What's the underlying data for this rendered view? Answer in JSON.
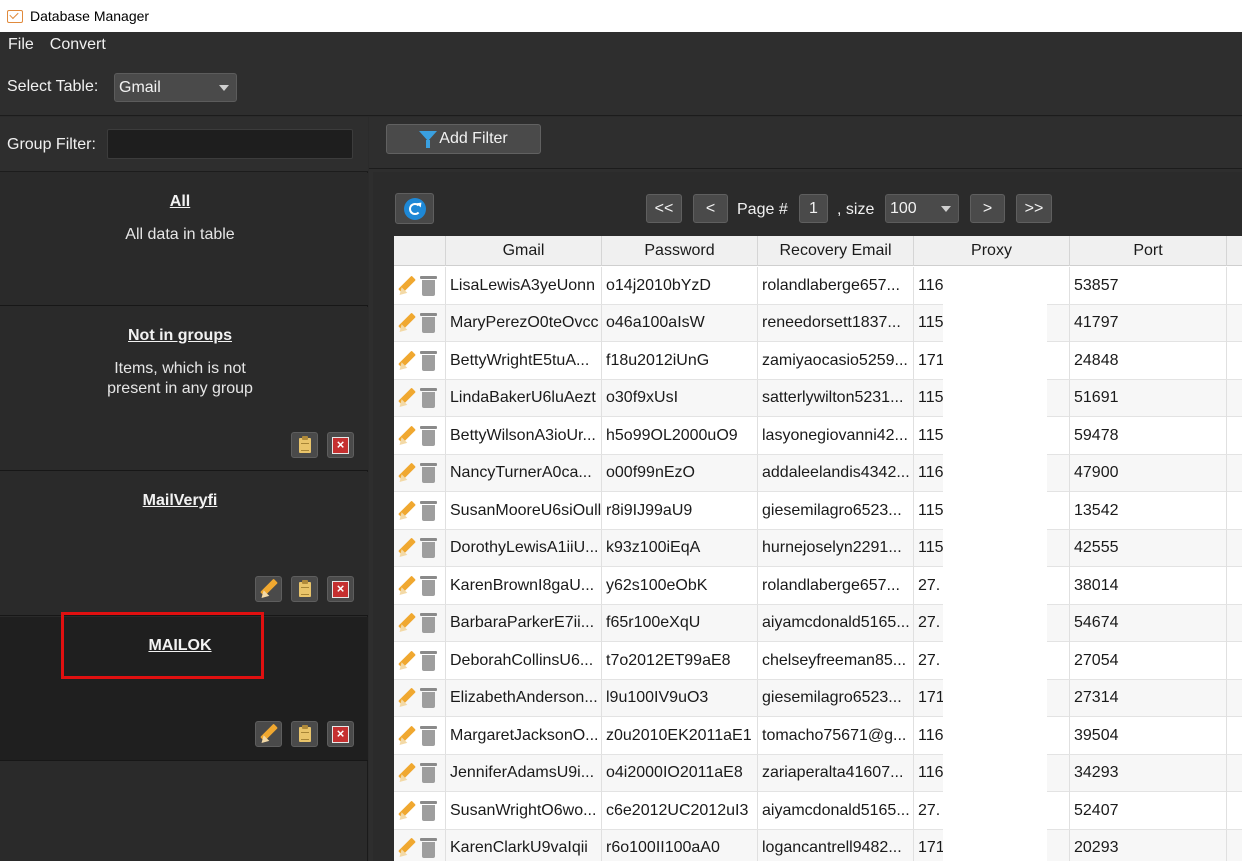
{
  "window": {
    "title": "Database Manager"
  },
  "menu": [
    "File",
    "Convert"
  ],
  "table_select": {
    "label": "Select Table:",
    "value": "Gmail"
  },
  "group_filter": {
    "label": "Group Filter:",
    "value": ""
  },
  "groups": [
    {
      "name": "All",
      "description": "All data in table"
    },
    {
      "name": "Not in groups",
      "description_lines": [
        "Items, which is not",
        "present in any group"
      ]
    },
    {
      "name": "MailVeryfi",
      "description": ""
    },
    {
      "name": "MAILOK",
      "description": ""
    }
  ],
  "toolbar": {
    "add_filter": "Add Filter"
  },
  "pager": {
    "first": "<<",
    "prev": "<",
    "page_label": "Page #",
    "page": "1",
    "size_label": ", size",
    "size": "100",
    "next": ">",
    "last": ">>"
  },
  "columns": [
    "Gmail",
    "Password",
    "Recovery Email",
    "Proxy",
    "Port"
  ],
  "rows": [
    [
      "LisaLewisA3yeUonn",
      "o14j2010bYzD",
      "rolandlaberge657...",
      "116",
      "53857"
    ],
    [
      "MaryPerezO0teOvcc",
      "o46a100aIsW",
      "reneedorsett1837...",
      "115",
      "41797"
    ],
    [
      "BettyWrightE5tuA...",
      "f18u2012iUnG",
      "zamiyaocasio5259...",
      "171",
      "24848"
    ],
    [
      "LindaBakerU6luAezt",
      "o30f9xUsI",
      "satterlywilton5231...",
      "115",
      "51691"
    ],
    [
      "BettyWilsonA3ioUr...",
      "h5o99OL2000uO9",
      "lasyonegiovanni42...",
      "115",
      "59478"
    ],
    [
      "NancyTurnerA0ca...",
      "o00f99nEzO",
      "addaleelandis4342...",
      "116",
      "47900"
    ],
    [
      "SusanMooreU6siOull",
      "r8i9IJ99aU9",
      "giesemilagro6523...",
      "115",
      "13542"
    ],
    [
      "DorothyLewisA1iiU...",
      "k93z100iEqA",
      "hurnejoselyn2291...",
      "115",
      "42555"
    ],
    [
      "KarenBrownI8gaU...",
      "y62s100eObK",
      "rolandlaberge657...",
      "27.",
      "38014"
    ],
    [
      "BarbaraParkerE7ii...",
      "f65r100eXqU",
      "aiyamcdonald5165...",
      "27.",
      "54674"
    ],
    [
      "DeborahCollinsU6...",
      "t7o2012ET99aE8",
      "chelseyfreeman85...",
      "27.",
      "27054"
    ],
    [
      "ElizabethAnderson...",
      "l9u100IV9uO3",
      "giesemilagro6523...",
      "171",
      "27314"
    ],
    [
      "MargaretJacksonO...",
      "z0u2010EK2011aE1",
      "tomacho75671@g...",
      "116",
      "39504"
    ],
    [
      "JenniferAdamsU9i...",
      "o4i2000IO2011aE8",
      "zariaperalta41607...",
      "116",
      "34293"
    ],
    [
      "SusanWrightO6wo...",
      "c6e2012UC2012uI3",
      "aiyamcdonald5165...",
      "27.",
      "52407"
    ],
    [
      "KarenClarkU9vaIqii",
      "r6o100II100aA0",
      "logancantrell9482...",
      "171",
      "20293"
    ]
  ]
}
